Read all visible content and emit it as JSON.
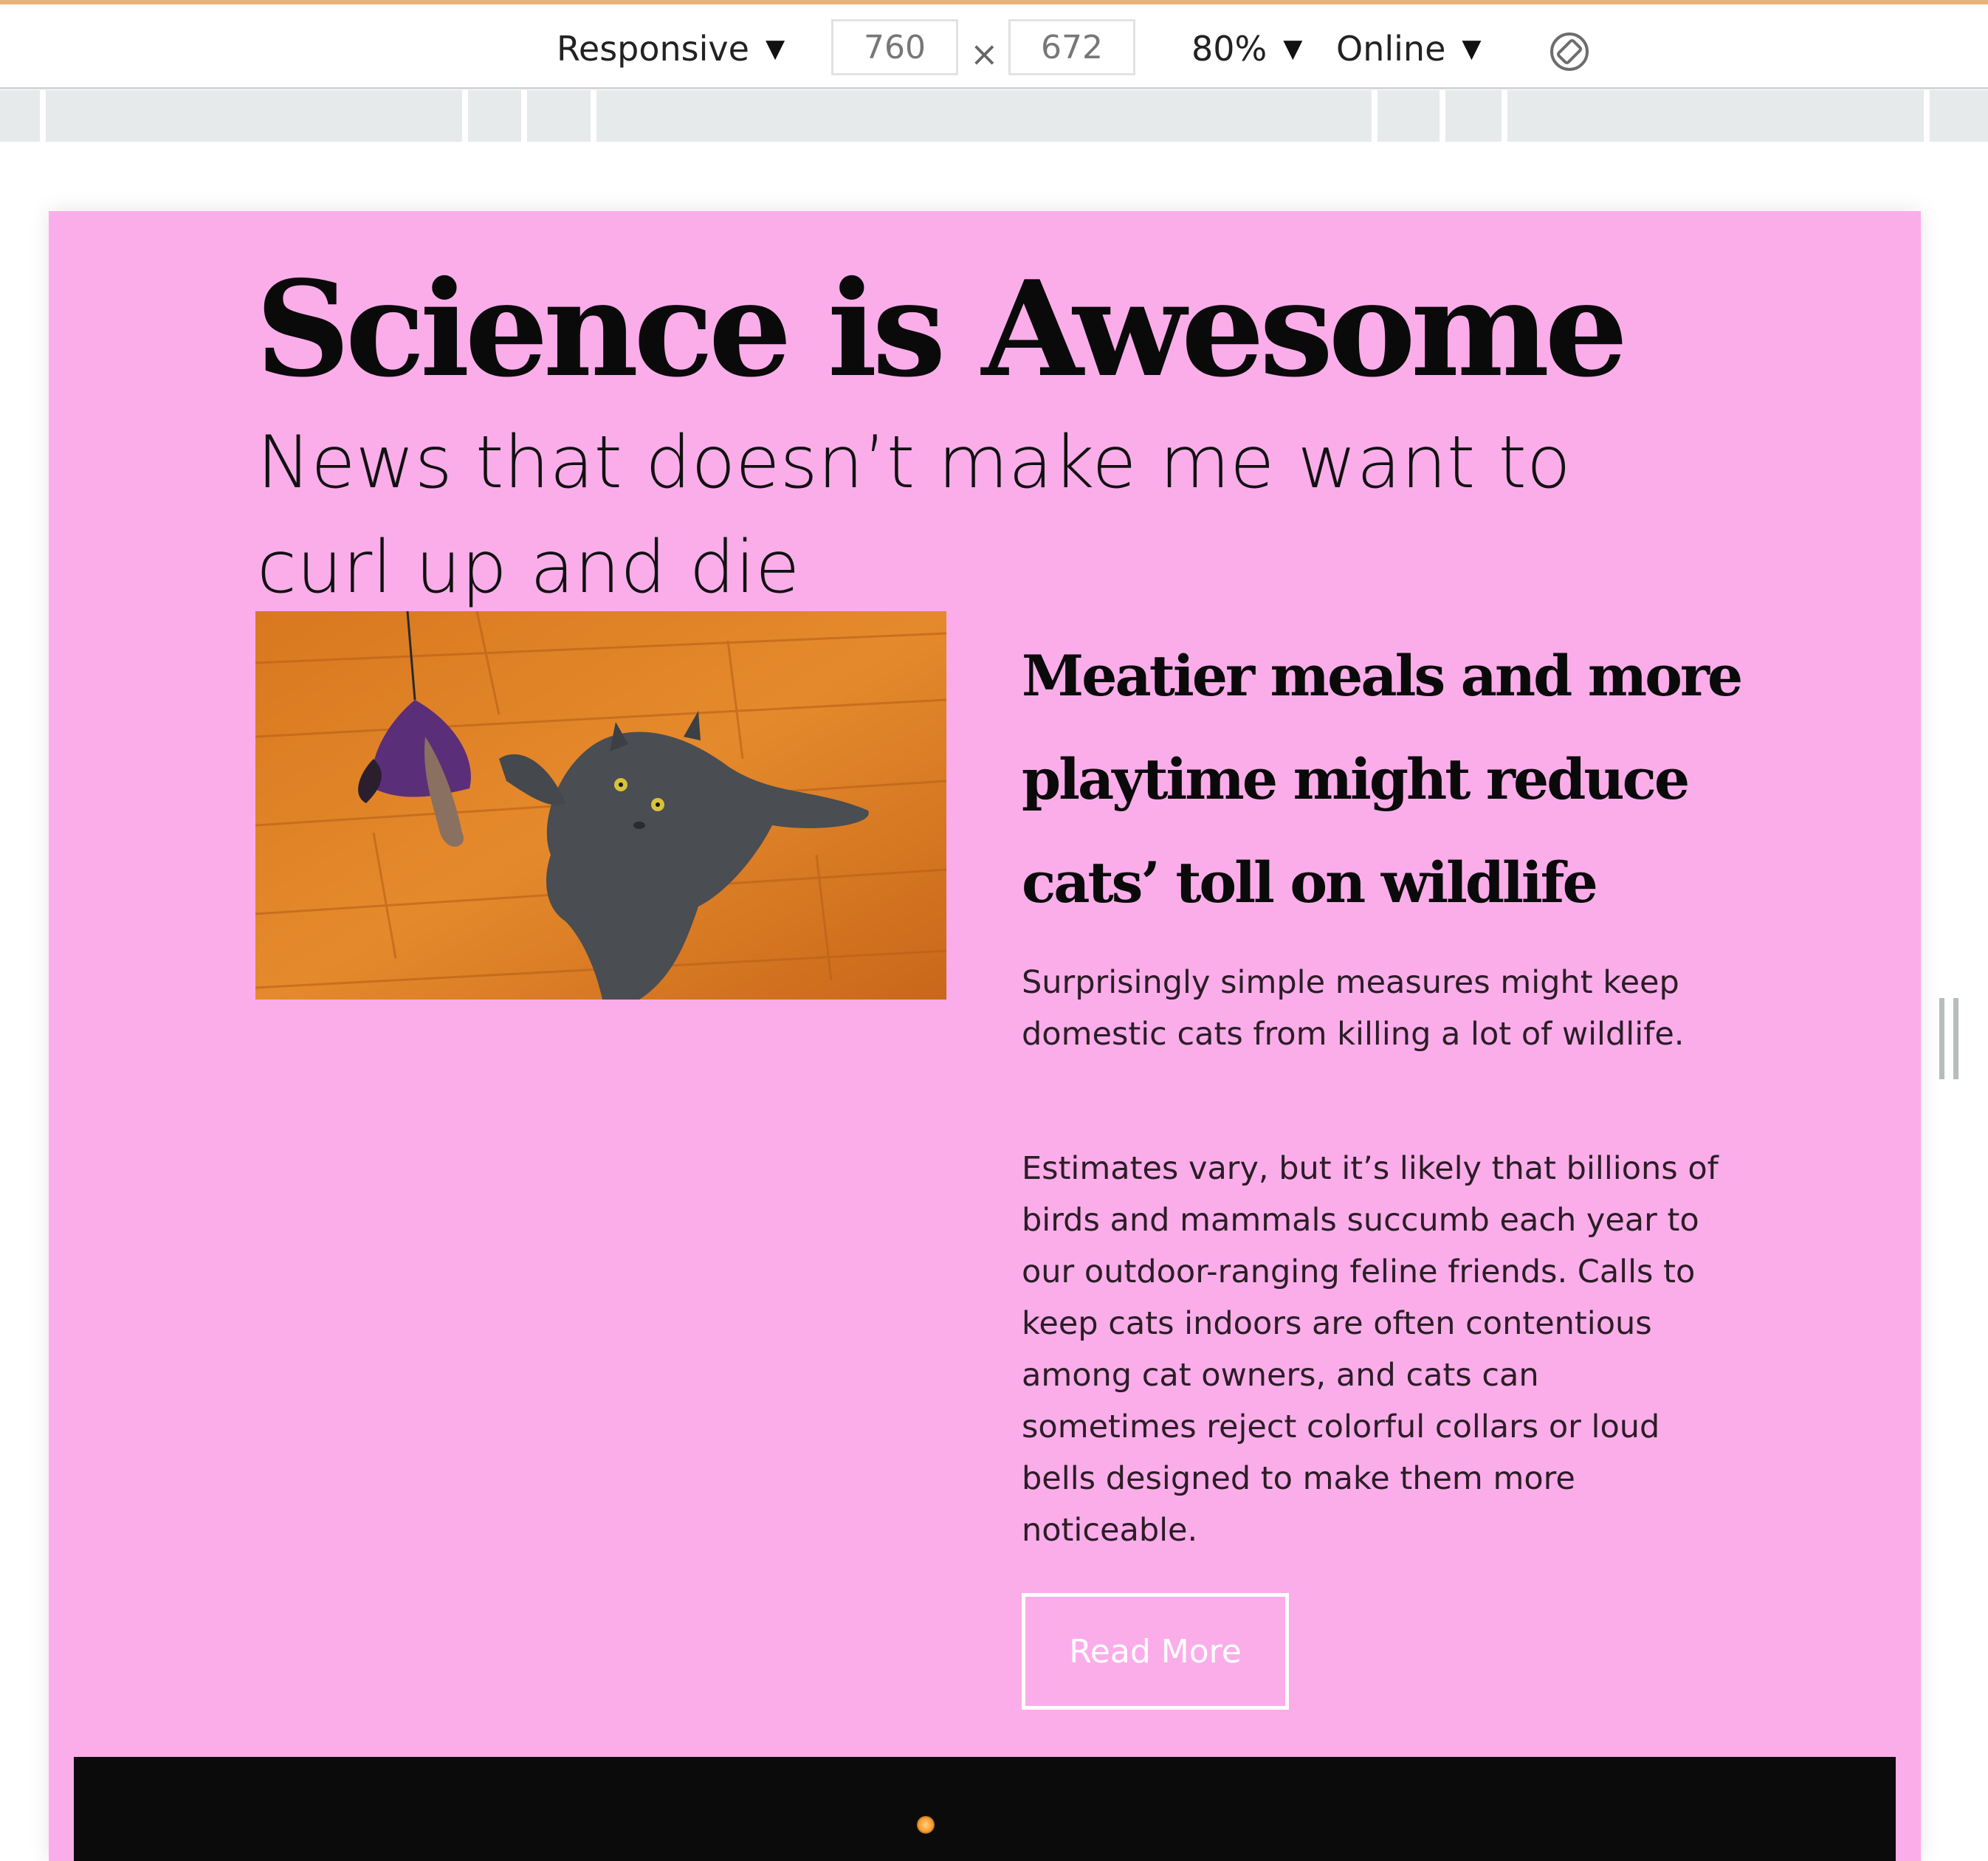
{
  "toolbar": {
    "device_mode": "Responsive",
    "width_value": "760",
    "height_value": "672",
    "times_symbol": "×",
    "zoom": "80%",
    "network": "Online",
    "caret": "▼",
    "rotate_icon": "rotate-icon"
  },
  "page": {
    "background_color": "#fbadea",
    "headline": "Science is Awesome",
    "subtitle": "News that doesn’t make me want to curl up and die",
    "article": {
      "title": "Meatier meals and more playtime might reduce cats’ toll on wildlife",
      "paragraph_1": "Surprisingly simple measures might keep domestic cats from killing a lot of wildlife.",
      "paragraph_2": "Estimates vary, but it’s likely that billions of birds and mammals succumb each year to our outdoor-ranging feline friends. Calls to keep cats indoors are often contentious among cat owners, and cats can sometimes reject colorful collars or loud bells designed to make them more noticeable.",
      "button_label": "Read More"
    }
  }
}
